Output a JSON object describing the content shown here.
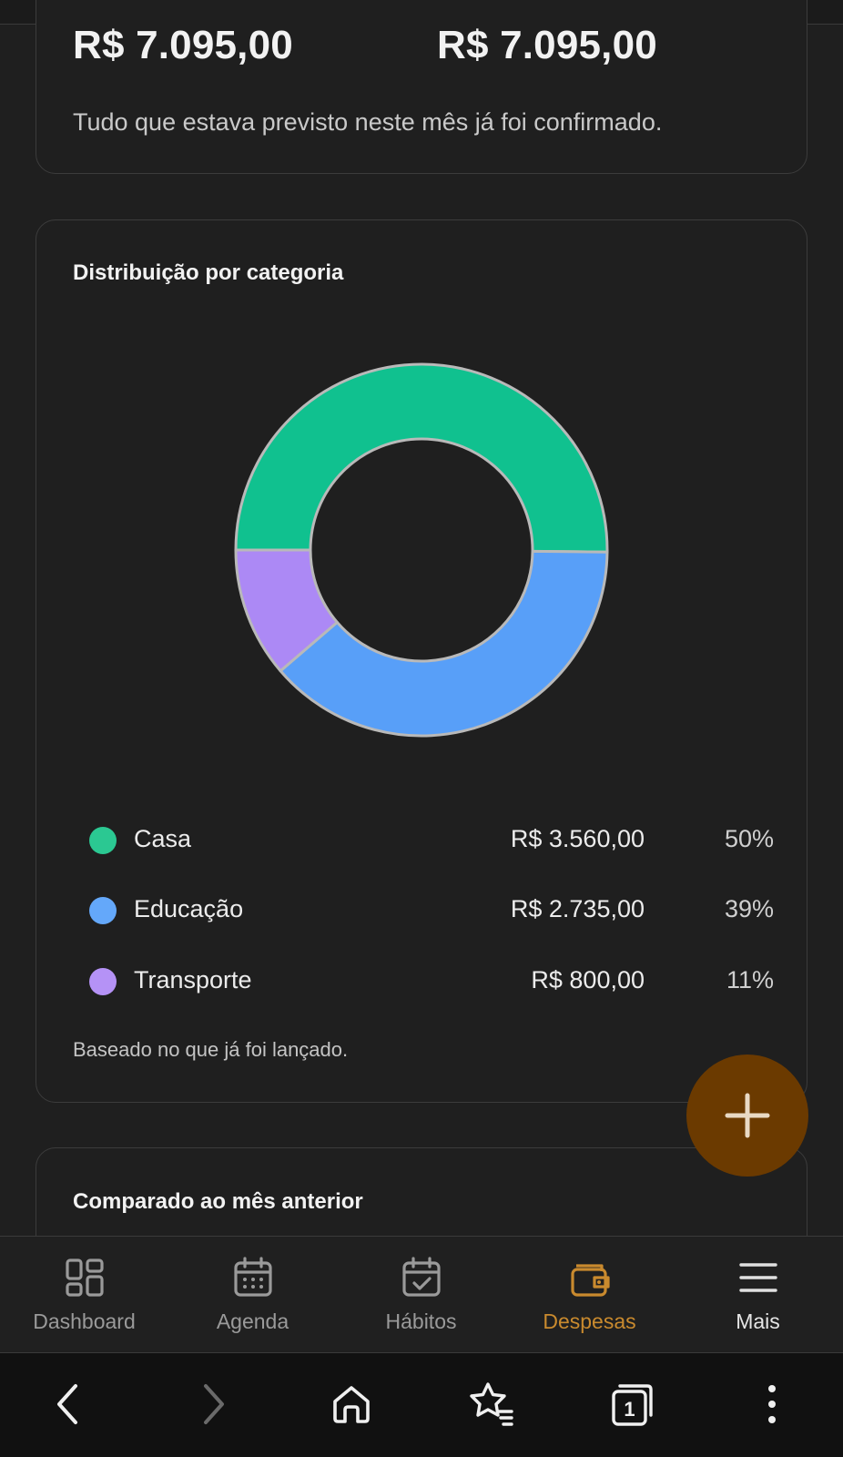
{
  "summary": {
    "amount_left": "R$ 7.095,00",
    "amount_right": "R$ 7.095,00",
    "note": "Tudo que estava previsto neste mês já foi confirmado."
  },
  "distribution": {
    "title": "Distribuição por categoria",
    "note": "Baseado no que já foi lançado.",
    "items": [
      {
        "name": "Casa",
        "value": "R$ 3.560,00",
        "percent": "50%",
        "color": "#10c18f"
      },
      {
        "name": "Educação",
        "value": "R$ 2.735,00",
        "percent": "39%",
        "color": "#589ff8"
      },
      {
        "name": "Transporte",
        "value": "R$ 800,00",
        "percent": "11%",
        "color": "#ac89f5"
      }
    ]
  },
  "chart_data": {
    "type": "pie",
    "categories": [
      "Casa",
      "Educação",
      "Transporte"
    ],
    "values": [
      3560,
      2735,
      800
    ],
    "title": "Distribuição por categoria"
  },
  "comparison": {
    "title": "Comparado ao mês anterior"
  },
  "fab": {
    "icon": "plus-icon"
  },
  "nav": {
    "items": [
      {
        "label": "Dashboard",
        "icon": "dashboard-icon"
      },
      {
        "label": "Agenda",
        "icon": "calendar-icon"
      },
      {
        "label": "Hábitos",
        "icon": "calendar-check-icon"
      },
      {
        "label": "Despesas",
        "icon": "wallet-icon",
        "active": true
      },
      {
        "label": "Mais",
        "icon": "menu-icon"
      }
    ],
    "active_color": "#c98a2e"
  },
  "system_bar": {
    "tab_count": "1",
    "icons": [
      "back-icon",
      "forward-icon",
      "home-icon",
      "bookmark-star-icon",
      "tabs-icon",
      "overflow-menu-icon"
    ]
  }
}
